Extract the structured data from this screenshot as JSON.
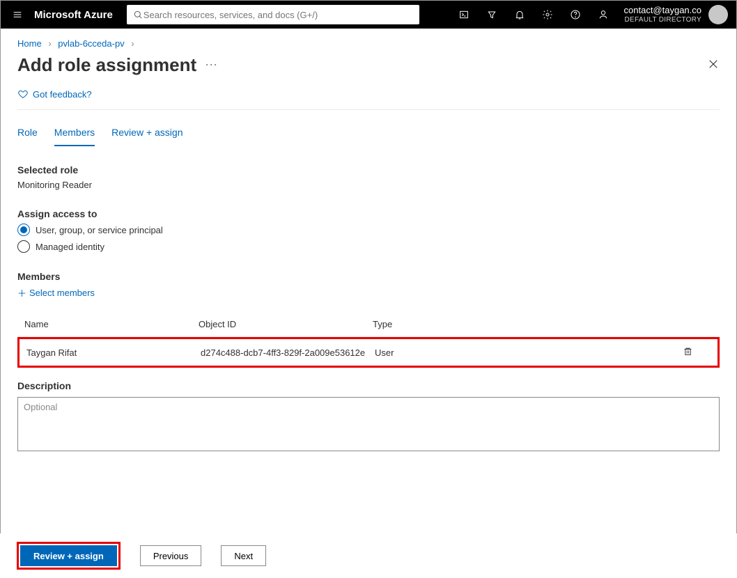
{
  "header": {
    "brand": "Microsoft Azure",
    "search_placeholder": "Search resources, services, and docs (G+/)",
    "account_email": "contact@taygan.co",
    "account_directory": "DEFAULT DIRECTORY"
  },
  "breadcrumb": {
    "items": [
      "Home",
      "pvlab-6cceda-pv"
    ]
  },
  "page": {
    "title": "Add role assignment",
    "feedback_label": "Got feedback?"
  },
  "tabs": {
    "items": [
      "Role",
      "Members",
      "Review + assign"
    ],
    "active_index": 1
  },
  "selected_role": {
    "heading": "Selected role",
    "value": "Monitoring Reader"
  },
  "assign_access": {
    "heading": "Assign access to",
    "options": [
      {
        "label": "User, group, or service principal",
        "checked": true
      },
      {
        "label": "Managed identity",
        "checked": false
      }
    ]
  },
  "members": {
    "heading": "Members",
    "select_label": "Select members",
    "columns": {
      "name": "Name",
      "object_id": "Object ID",
      "type": "Type"
    },
    "rows": [
      {
        "name": "Taygan Rifat",
        "object_id": "d274c488-dcb7-4ff3-829f-2a009e53612e",
        "type": "User"
      }
    ]
  },
  "description": {
    "heading": "Description",
    "placeholder": "Optional",
    "value": ""
  },
  "footer": {
    "review_assign": "Review + assign",
    "previous": "Previous",
    "next": "Next"
  }
}
